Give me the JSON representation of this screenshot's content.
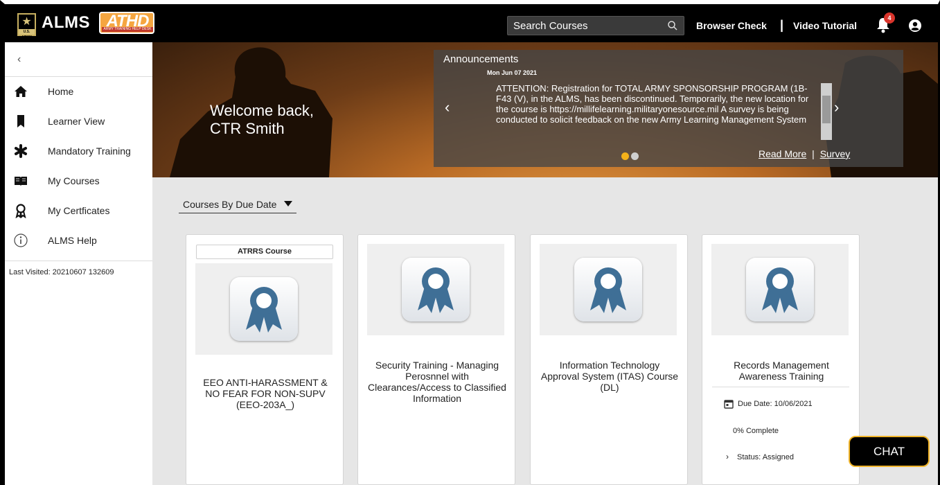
{
  "header": {
    "app_title": "ALMS",
    "army_logo_text": "U.S. ARMY",
    "athd_logo_text": "ATHD",
    "athd_logo_subtitle": "ARMY TRAINING HELP DESK",
    "search_placeholder": "Search Courses",
    "browser_check": "Browser Check",
    "separator": "|",
    "video_tutorial": "Video Tutorial",
    "notification_count": "4"
  },
  "sidebar": {
    "collapse_glyph": "‹",
    "items": [
      {
        "label": "Home",
        "icon": "home-icon"
      },
      {
        "label": "Learner View",
        "icon": "bookmark-icon"
      },
      {
        "label": "Mandatory Training",
        "icon": "asterisk-icon"
      },
      {
        "label": "My Courses",
        "icon": "book-icon"
      },
      {
        "label": "My Certficates",
        "icon": "ribbon-icon"
      },
      {
        "label": "ALMS Help",
        "icon": "info-icon"
      }
    ],
    "last_visited": "Last Visited: 20210607 132609"
  },
  "hero": {
    "welcome_line1": "Welcome back,",
    "welcome_line2": "CTR Smith",
    "announcements": {
      "title": "Announcements",
      "date": "Mon Jun 07 2021",
      "text": "ATTENTION: Registration for TOTAL ARMY SPONSORSHIP PROGRAM (1B-F43 (V), in the ALMS, has been discontinued. Temporarily, the new location for the course is https://millifelearning.militaryonesource.mil A survey is being conducted to solicit feedback on the new Army Learning Management System (ALMS) user interface. Please use the Survey link",
      "read_more": "Read More",
      "links_separator": "|",
      "survey": "Survey",
      "prev_glyph": "‹",
      "next_glyph": "›",
      "dot_colors": [
        "#f5b21a",
        "#cfcfcf"
      ]
    }
  },
  "main": {
    "sort_label": "Courses By Due Date",
    "courses": [
      {
        "tag": "ATRRS Course",
        "title": "EEO ANTI-HARASSMENT & NO FEAR FOR NON-SUPV (EEO-203A_)"
      },
      {
        "tag": "",
        "title": "Security Training - Managing Perosnnel with Clearances/Access to Classified Information"
      },
      {
        "tag": "",
        "title": "Information Technology Approval System (ITAS) Course (DL)"
      },
      {
        "tag": "",
        "title": "Records Management Awareness Training",
        "due_date": "Due Date:  10/06/2021",
        "percent_complete": "0% Complete",
        "status": "Status: Assigned"
      }
    ]
  },
  "chat": {
    "label": "CHAT"
  },
  "colors": {
    "ribbon_blue": "#3f6f96",
    "accent_gold": "#f0b429",
    "badge_red": "#d9342b"
  }
}
